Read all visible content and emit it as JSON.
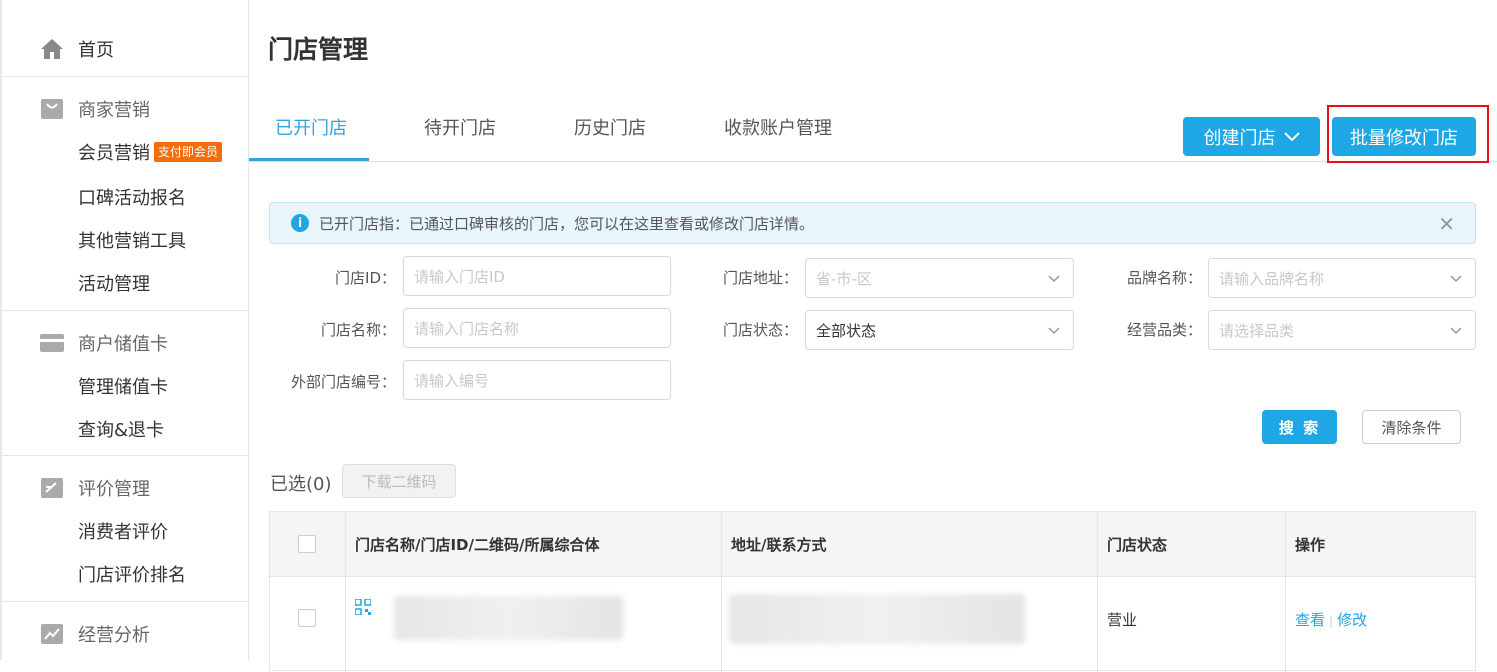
{
  "sidebar": {
    "home": "首页",
    "groups": [
      {
        "title": "商家营销",
        "icon": "shopping-bag-icon",
        "items": [
          "会员营销",
          "口碑活动报名",
          "其他营销工具",
          "活动管理"
        ],
        "badge": "支付即会员"
      },
      {
        "title": "商户储值卡",
        "icon": "card-icon",
        "items": [
          "管理储值卡",
          "查询&退卡"
        ]
      },
      {
        "title": "评价管理",
        "icon": "edit-icon",
        "items": [
          "消费者评价",
          "门店评价排名"
        ]
      },
      {
        "title": "经营分析",
        "icon": "chart-icon",
        "items": []
      }
    ]
  },
  "page_title": "门店管理",
  "tabs": [
    "已开门店",
    "待开门店",
    "历史门店",
    "收款账户管理"
  ],
  "actions": {
    "create": "创建门店",
    "batch_edit": "批量修改门店"
  },
  "alert": {
    "text": "已开门店指：已通过口碑审核的门店，您可以在这里查看或修改门店详情。"
  },
  "filters": {
    "store_id": {
      "label": "门店ID：",
      "placeholder": "请输入门店ID"
    },
    "store_address": {
      "label": "门店地址：",
      "placeholder": "省-市-区"
    },
    "brand_name": {
      "label": "品牌名称：",
      "placeholder": "请输入品牌名称"
    },
    "store_name": {
      "label": "门店名称：",
      "placeholder": "请输入门店名称"
    },
    "store_status": {
      "label": "门店状态：",
      "value": "全部状态"
    },
    "category": {
      "label": "经营品类：",
      "placeholder": "请选择品类"
    },
    "external_no": {
      "label": "外部门店编号：",
      "placeholder": "请输入编号"
    }
  },
  "search_label": "搜 索",
  "clear_label": "清除条件",
  "selected_text": "已选(0)",
  "download_qr": "下载二维码",
  "table": {
    "headers": [
      "门店名称/门店ID/二维码/所属综合体",
      "地址/联系方式",
      "门店状态",
      "操作"
    ],
    "rows": [
      {
        "status": "营业",
        "view": "查看",
        "edit": "修改"
      }
    ]
  },
  "colors": {
    "accent": "#1ea7e4",
    "badge": "#f56c0c",
    "highlight": "#e3121a"
  }
}
